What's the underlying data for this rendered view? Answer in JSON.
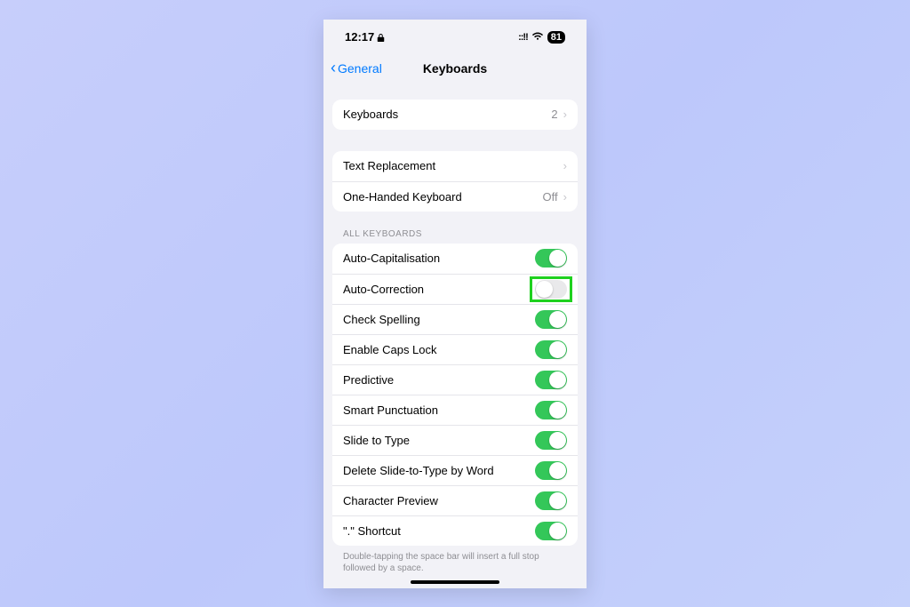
{
  "status": {
    "time": "12:17",
    "battery": "81"
  },
  "nav": {
    "back_label": "General",
    "title": "Keyboards"
  },
  "group1": {
    "keyboards_label": "Keyboards",
    "keyboards_count": "2"
  },
  "group2": {
    "text_replacement_label": "Text Replacement",
    "one_handed_label": "One-Handed Keyboard",
    "one_handed_value": "Off"
  },
  "section_header": "ALL KEYBOARDS",
  "toggles": [
    {
      "label": "Auto-Capitalisation",
      "on": true
    },
    {
      "label": "Auto-Correction",
      "on": false,
      "highlighted": true
    },
    {
      "label": "Check Spelling",
      "on": true
    },
    {
      "label": "Enable Caps Lock",
      "on": true
    },
    {
      "label": "Predictive",
      "on": true
    },
    {
      "label": "Smart Punctuation",
      "on": true
    },
    {
      "label": "Slide to Type",
      "on": true
    },
    {
      "label": "Delete Slide-to-Type by Word",
      "on": true
    },
    {
      "label": "Character Preview",
      "on": true
    },
    {
      "label": "\".\" Shortcut",
      "on": true
    }
  ],
  "footer": "Double-tapping the space bar will insert a full stop followed by a space."
}
